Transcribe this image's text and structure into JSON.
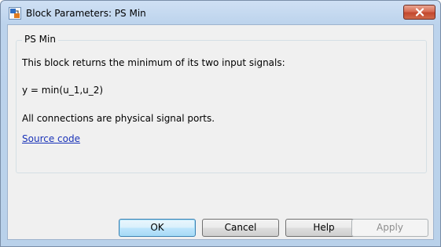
{
  "window": {
    "title": "Block Parameters: PS Min"
  },
  "group": {
    "title": "PS Min"
  },
  "description": {
    "line1": "This block returns the minimum of its two input signals:",
    "equation": "y = min(u_1,u_2)",
    "line3": "All connections are physical signal ports.",
    "link_label": "Source code"
  },
  "buttons": {
    "ok": "OK",
    "cancel": "Cancel",
    "help": "Help",
    "apply": "Apply"
  },
  "icons": {
    "app": "simulink-block-icon",
    "close": "close-icon"
  },
  "colors": {
    "link": "#1a33b8",
    "close_button": "#c3482e",
    "default_button_border": "#3c7fb1"
  }
}
